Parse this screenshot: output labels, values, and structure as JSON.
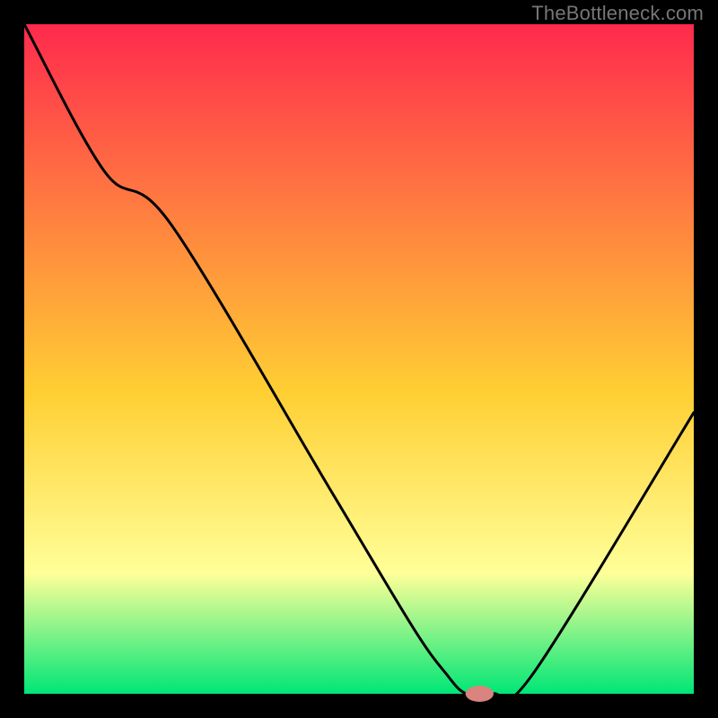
{
  "brand": {
    "text": "TheBottleneck.com"
  },
  "colors": {
    "frame": "#000000",
    "curve": "#000000",
    "marker": "#d9847e",
    "gradient_top": "#ff2a4d",
    "gradient_mid": "#ffcf33",
    "gradient_band": "#ffff99",
    "gradient_bottom": "#00e676"
  },
  "layout": {
    "outer_w": 800,
    "outer_h": 800,
    "frame_left": 27,
    "frame_right": 27,
    "frame_top": 27,
    "frame_bottom": 27
  },
  "chart_data": {
    "type": "line",
    "title": "",
    "xlabel": "",
    "ylabel": "",
    "xlim": [
      0,
      100
    ],
    "ylim": [
      0,
      100
    ],
    "x": [
      0,
      12,
      22,
      46,
      58,
      63,
      66,
      70,
      76,
      100
    ],
    "values": [
      100,
      78,
      70,
      30,
      10,
      3,
      0,
      0,
      3,
      42
    ],
    "marker": {
      "x": 68,
      "y": 0,
      "rx": 2.1,
      "ry": 1.2
    }
  }
}
